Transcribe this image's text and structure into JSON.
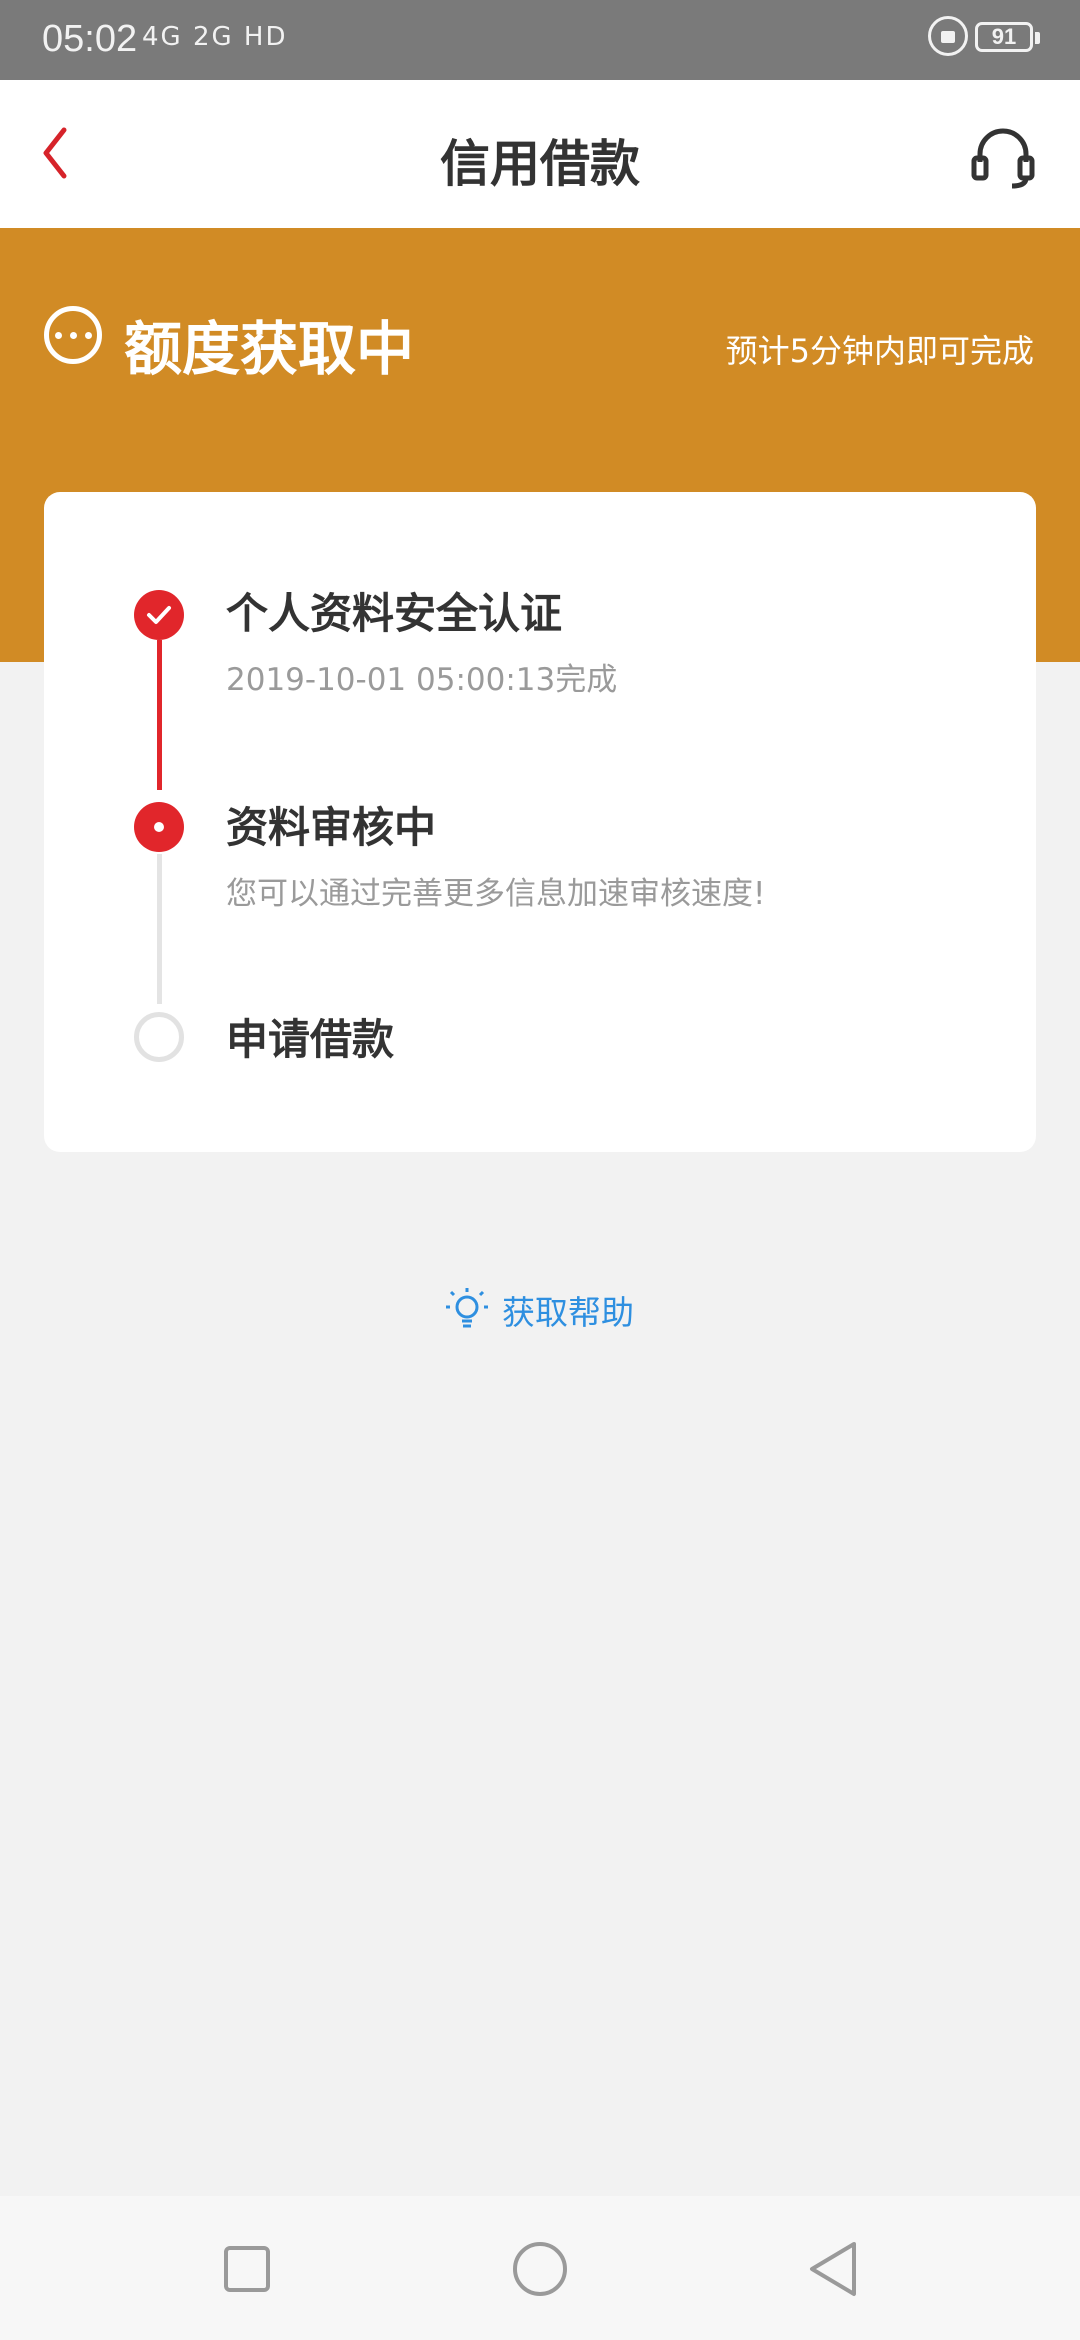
{
  "status_bar": {
    "time": "05:02",
    "signal_text": "4G 2G HD",
    "battery": "91"
  },
  "header": {
    "title": "信用借款",
    "back_icon": "chevron-left-icon",
    "service_icon": "headset-icon"
  },
  "banner": {
    "status": "额度获取中",
    "eta": "预计5分钟内即可完成",
    "color": "#d18b25"
  },
  "steps": [
    {
      "title": "个人资料安全认证",
      "subtitle": "2019-10-01 05:00:13完成",
      "state": "done"
    },
    {
      "title": "资料审核中",
      "subtitle": "您可以通过完善更多信息加速审核速度!",
      "state": "active"
    },
    {
      "title": "申请借款",
      "subtitle": "",
      "state": "pending"
    }
  ],
  "help": {
    "label": "获取帮助",
    "icon": "lightbulb-icon",
    "color": "#2e8fe0"
  },
  "nav": {
    "recent_icon": "square-icon",
    "home_icon": "circle-icon",
    "back_icon": "triangle-back-icon"
  },
  "colors": {
    "accent_red": "#e1262b",
    "banner_orange": "#d18b25"
  }
}
